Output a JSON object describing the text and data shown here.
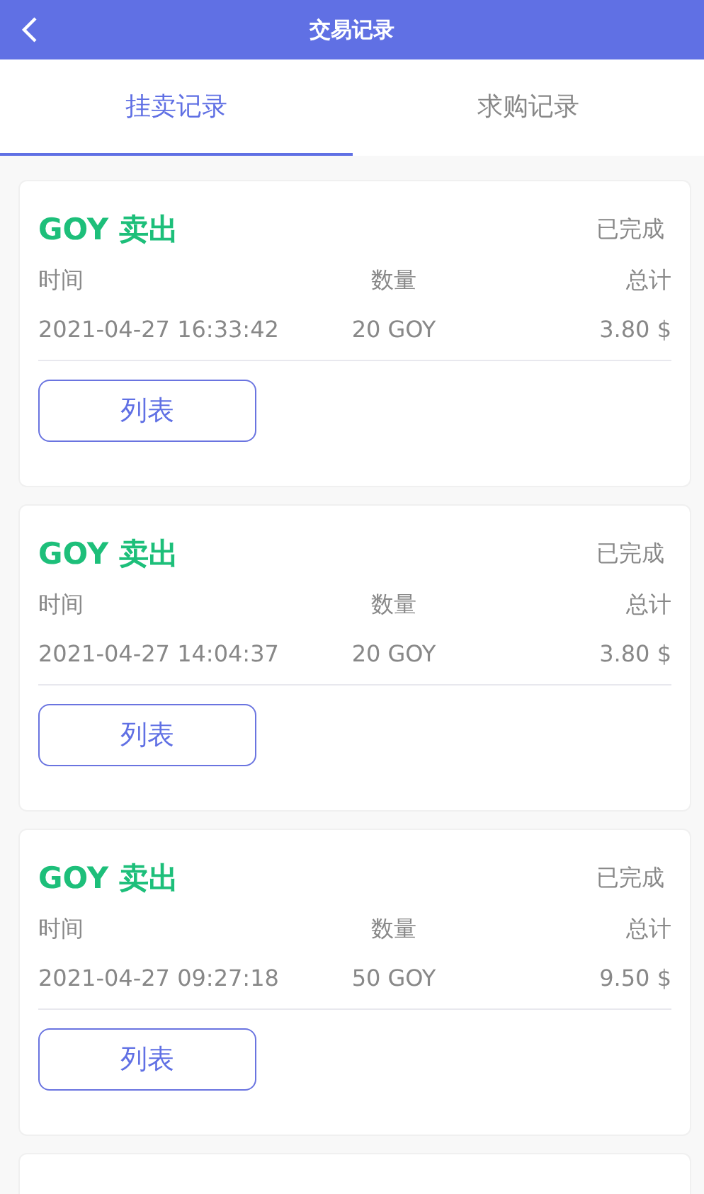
{
  "header": {
    "title": "交易记录"
  },
  "tabs": [
    {
      "label": "挂卖记录",
      "selected": true
    },
    {
      "label": "求购记录",
      "selected": false
    }
  ],
  "records": [
    {
      "kind": "full",
      "title": "GOY 卖出",
      "status": "已完成",
      "labels": [
        "时间",
        "数量",
        "总计"
      ],
      "time": "2021-04-27 16:33:42",
      "quantity": "20 GOY",
      "total": "3.80 $",
      "button": "列表"
    },
    {
      "kind": "full",
      "title": "GOY 卖出",
      "status": "已完成",
      "labels": [
        "时间",
        "数量",
        "总计"
      ],
      "time": "2021-04-27 14:04:37",
      "quantity": "20 GOY",
      "total": "3.80 $",
      "button": "列表"
    },
    {
      "kind": "full",
      "title": "GOY 卖出",
      "status": "已完成",
      "labels": [
        "时间",
        "数量",
        "总计"
      ],
      "time": "2021-04-27 09:27:18",
      "quantity": "50 GOY",
      "total": "9.50 $",
      "button": "列表"
    },
    {
      "kind": "partial"
    }
  ]
}
